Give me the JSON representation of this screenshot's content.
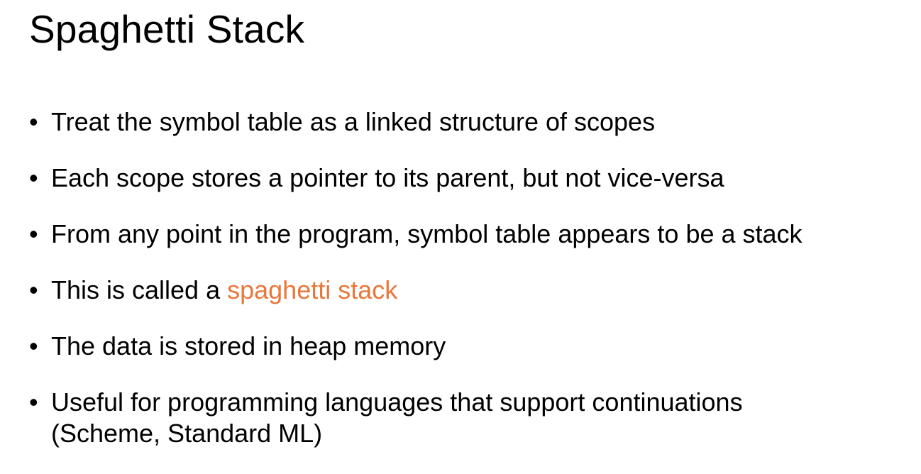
{
  "slide": {
    "title": "Spaghetti Stack",
    "bullets": [
      {
        "text": "Treat the symbol table as a linked structure of scopes"
      },
      {
        "text": "Each scope stores a pointer to its parent, but not vice-versa"
      },
      {
        "text": "From any point in the program, symbol table appears to be a stack"
      },
      {
        "prefix": "This is called a ",
        "highlight": "spaghetti stack"
      },
      {
        "text": "The data is stored in heap memory"
      },
      {
        "line1": "Useful for programming languages that support continuations",
        "line2": "(Scheme, Standard ML)"
      }
    ],
    "bullet_glyph": "•",
    "colors": {
      "text": "#000000",
      "accent": "#e8773a",
      "background": "#ffffff"
    }
  }
}
